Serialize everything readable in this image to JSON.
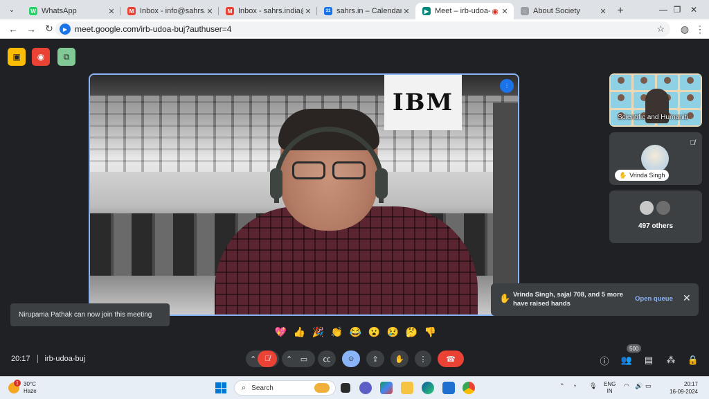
{
  "browser": {
    "tabs": [
      {
        "title": "WhatsApp",
        "favicon_color": "#25d366",
        "favicon_glyph": "W",
        "active": false
      },
      {
        "title": "Inbox - info@sahrs.in - sah",
        "favicon_color": "#ea4335",
        "favicon_glyph": "M",
        "active": false
      },
      {
        "title": "Inbox - sahrs.india@gmail",
        "favicon_color": "#ea4335",
        "favicon_glyph": "M",
        "active": false
      },
      {
        "title": "sahrs.in – Calendar - Mond",
        "favicon_color": "#1a73e8",
        "favicon_glyph": "31",
        "active": false
      },
      {
        "title": "Meet – irb-udoa-buj",
        "favicon_color": "#00897b",
        "favicon_glyph": "▶",
        "active": true
      },
      {
        "title": "About Society",
        "favicon_color": "#9aa0a6",
        "favicon_glyph": "◌",
        "active": false
      }
    ],
    "url": "meet.google.com/irb-udoa-buj?authuser=4"
  },
  "meeting": {
    "main_video": {
      "sign_text": "IBM"
    },
    "tiles": [
      {
        "label": "Scientific and Humaniti"
      },
      {
        "name": "Vrinda Singh"
      },
      {
        "others": "497 others"
      }
    ],
    "toast": "Nirupama Pathak can now join this meeting",
    "raised_hands": {
      "text": "Vrinda Singh, sajal 708, and 5 more have raised hands",
      "action": "Open queue"
    },
    "reactions": [
      "💖",
      "👍",
      "🎉",
      "👏",
      "😂",
      "😮",
      "😢",
      "🤔",
      "👎"
    ],
    "time": "20:17",
    "code": "irb-udoa-buj",
    "people_count": "500"
  },
  "taskbar": {
    "weather_temp": "30°C",
    "weather_desc": "Haze",
    "weather_badge": "1",
    "search_placeholder": "Search",
    "lang": "ENG",
    "region": "IN",
    "clock_time": "20:17",
    "clock_date": "16-09-2024"
  },
  "colors": {
    "meet_bg": "#202124",
    "accent_blue": "#8ab4f8",
    "end_call_red": "#ea4335"
  }
}
